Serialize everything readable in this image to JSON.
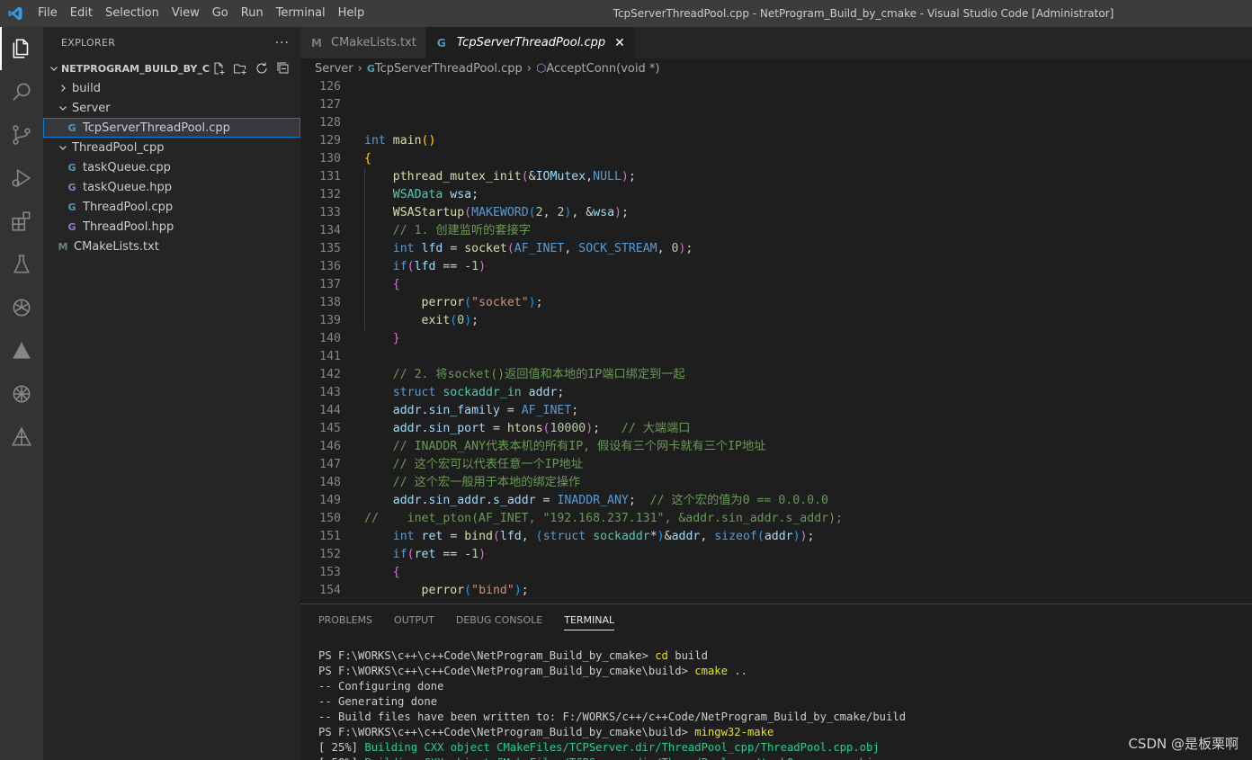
{
  "titlebar": {
    "menu": [
      "File",
      "Edit",
      "Selection",
      "View",
      "Go",
      "Run",
      "Terminal",
      "Help"
    ],
    "window_title": "TcpServerThreadPool.cpp - NetProgram_Build_by_cmake - Visual Studio Code [Administrator]"
  },
  "colors": {
    "accent": "#007acc",
    "cpp_icon": "#519aba",
    "hpp_icon": "#a074c4",
    "cmake_icon": "#6d8086"
  },
  "activity": [
    "explorer-icon",
    "search-icon",
    "source-control-icon",
    "run-debug-icon",
    "extensions-icon",
    "testing-icon",
    "openai-icon",
    "cmake-icon",
    "chatgpt-icon",
    "deploy-icon"
  ],
  "sidebar": {
    "title": "EXPLORER",
    "more": "···",
    "root": "NETPROGRAM_BUILD_BY_CM...",
    "tree": [
      {
        "label": "build",
        "type": "folder",
        "depth": 1,
        "open": false
      },
      {
        "label": "Server",
        "type": "folder",
        "depth": 1,
        "open": true
      },
      {
        "label": "TcpServerThreadPool.cpp",
        "type": "cpp",
        "depth": 2,
        "selected": true
      },
      {
        "label": "ThreadPool_cpp",
        "type": "folder",
        "depth": 1,
        "open": true
      },
      {
        "label": "taskQueue.cpp",
        "type": "cpp",
        "depth": 2
      },
      {
        "label": "taskQueue.hpp",
        "type": "hpp",
        "depth": 2
      },
      {
        "label": "ThreadPool.cpp",
        "type": "cpp",
        "depth": 2
      },
      {
        "label": "ThreadPool.hpp",
        "type": "hpp",
        "depth": 2
      },
      {
        "label": "CMakeLists.txt",
        "type": "cmake",
        "depth": 1
      }
    ]
  },
  "editor": {
    "tabs": [
      {
        "label": "CMakeLists.txt",
        "icon": "M",
        "active": false
      },
      {
        "label": "TcpServerThreadPool.cpp",
        "icon": "G",
        "active": true
      }
    ],
    "breadcrumb": [
      "Server",
      "TcpServerThreadPool.cpp",
      "AcceptConn(void *)"
    ],
    "lines": [
      {
        "n": "126",
        "html": ""
      },
      {
        "n": "127",
        "html": ""
      },
      {
        "n": "128",
        "html": ""
      },
      {
        "n": "129",
        "html": "<span class='kw'>int</span> <span class='fn'>main</span><span class='b1'>()</span>"
      },
      {
        "n": "130",
        "html": "<span class='b1'>{</span>"
      },
      {
        "n": "131",
        "html": "    <span class='fn'>pthread_mutex_init</span><span class='b2'>(</span>&amp;<span class='var'>IOMutex</span>,<span class='kw'>NULL</span><span class='b2'>)</span>;"
      },
      {
        "n": "132",
        "html": "    <span class='ty'>WSAData</span> <span class='var'>wsa</span>;"
      },
      {
        "n": "133",
        "html": "    <span class='fn'>WSAStartup</span><span class='b2'>(</span><span class='mac'>MAKEWORD</span><span class='b3'>(</span><span class='num'>2</span>, <span class='num'>2</span><span class='b3'>)</span>, &amp;<span class='var'>wsa</span><span class='b2'>)</span>;"
      },
      {
        "n": "134",
        "html": "    <span class='cm'>// 1. 创建监听的套接字</span>"
      },
      {
        "n": "135",
        "html": "    <span class='kw'>int</span> <span class='var'>lfd</span> = <span class='fn'>socket</span><span class='b2'>(</span><span class='mac'>AF_INET</span>, <span class='mac'>SOCK_STREAM</span>, <span class='num'>0</span><span class='b2'>)</span>;"
      },
      {
        "n": "136",
        "html": "    <span class='kw'>if</span><span class='b2'>(</span><span class='var'>lfd</span> == -<span class='num'>1</span><span class='b2'>)</span>"
      },
      {
        "n": "137",
        "html": "    <span class='b2'>{</span>"
      },
      {
        "n": "138",
        "html": "        <span class='fn'>perror</span><span class='b3'>(</span><span class='str'>\"socket\"</span><span class='b3'>)</span>;"
      },
      {
        "n": "139",
        "html": "        <span class='fn'>exit</span><span class='b3'>(</span><span class='num'>0</span><span class='b3'>)</span>;"
      },
      {
        "n": "140",
        "html": "    <span class='b2'>}</span>"
      },
      {
        "n": "141",
        "html": ""
      },
      {
        "n": "142",
        "html": "    <span class='cm'>// 2. 将socket()返回值和本地的IP端口绑定到一起</span>"
      },
      {
        "n": "143",
        "html": "    <span class='kw'>struct</span> <span class='ty'>sockaddr_in</span> <span class='var'>addr</span>;"
      },
      {
        "n": "144",
        "html": "    <span class='var'>addr</span>.<span class='var'>sin_family</span> = <span class='mac'>AF_INET</span>;"
      },
      {
        "n": "145",
        "html": "    <span class='var'>addr</span>.<span class='var'>sin_port</span> = <span class='fn'>htons</span><span class='b2'>(</span><span class='num'>10000</span><span class='b2'>)</span>;   <span class='cm'>// 大端端口</span>"
      },
      {
        "n": "146",
        "html": "    <span class='cm'>// INADDR_ANY代表本机的所有IP, 假设有三个网卡就有三个IP地址</span>"
      },
      {
        "n": "147",
        "html": "    <span class='cm'>// 这个宏可以代表任意一个IP地址</span>"
      },
      {
        "n": "148",
        "html": "    <span class='cm'>// 这个宏一般用于本地的绑定操作</span>"
      },
      {
        "n": "149",
        "html": "    <span class='var'>addr</span>.<span class='var'>sin_addr</span>.<span class='var'>s_addr</span> = <span class='mac'>INADDR_ANY</span>;  <span class='cm'>// 这个宏的值为0 == 0.0.0.0</span>"
      },
      {
        "n": "150",
        "html": "<span class='cm'>//    inet_pton(AF_INET, \"192.168.237.131\", &amp;addr.sin_addr.s_addr);</span>"
      },
      {
        "n": "151",
        "html": "    <span class='kw'>int</span> <span class='var'>ret</span> = <span class='fn'>bind</span><span class='b2'>(</span><span class='var'>lfd</span>, <span class='b3'>(</span><span class='kw'>struct</span> <span class='ty'>sockaddr</span>*<span class='b3'>)</span>&amp;<span class='var'>addr</span>, <span class='kw'>sizeof</span><span class='b3'>(</span><span class='var'>addr</span><span class='b3'>)</span><span class='b2'>)</span>;"
      },
      {
        "n": "152",
        "html": "    <span class='kw'>if</span><span class='b2'>(</span><span class='var'>ret</span> == -<span class='num'>1</span><span class='b2'>)</span>"
      },
      {
        "n": "153",
        "html": "    <span class='b2'>{</span>"
      },
      {
        "n": "154",
        "html": "        <span class='fn'>perror</span><span class='b3'>(</span><span class='str'>\"bind\"</span><span class='b3'>)</span>;"
      }
    ]
  },
  "panel": {
    "tabs": [
      {
        "label": "PROBLEMS",
        "active": false
      },
      {
        "label": "OUTPUT",
        "active": false
      },
      {
        "label": "DEBUG CONSOLE",
        "active": false
      },
      {
        "label": "TERMINAL",
        "active": true
      }
    ],
    "terminal": [
      {
        "prompt": "PS F:\\WORKS\\c++\\c++Code\\NetProgram_Build_by_cmake> ",
        "cmd": "cd",
        "rest": " build",
        "style": ""
      },
      {
        "prompt": "PS F:\\WORKS\\c++\\c++Code\\NetProgram_Build_by_cmake\\build> ",
        "cmd": "cmake",
        "rest": " ..",
        "style": ""
      },
      {
        "prompt": "",
        "cmd": "",
        "rest": "-- Configuring done",
        "style": ""
      },
      {
        "prompt": "",
        "cmd": "",
        "rest": "-- Generating done",
        "style": ""
      },
      {
        "prompt": "",
        "cmd": "",
        "rest": "-- Build files have been written to: F:/WORKS/c++/c++Code/NetProgram_Build_by_cmake/build",
        "style": ""
      },
      {
        "prompt": "PS F:\\WORKS\\c++\\c++Code\\NetProgram_Build_by_cmake\\build> ",
        "cmd": "mingw32-make",
        "rest": "",
        "style": ""
      },
      {
        "prompt": "[ 25%] ",
        "cmd": "",
        "rest": "Building CXX object CMakeFiles/TCPServer.dir/ThreadPool_cpp/ThreadPool.cpp.obj",
        "style": "grn"
      },
      {
        "prompt": "[ 50%] ",
        "cmd": "",
        "rest": "Building CXX object CMakeFiles/TCPServer.dir/ThreadPool_cpp/taskQueue.cpp.obj",
        "style": "grn"
      }
    ]
  },
  "watermark": "CSDN @是板栗啊"
}
